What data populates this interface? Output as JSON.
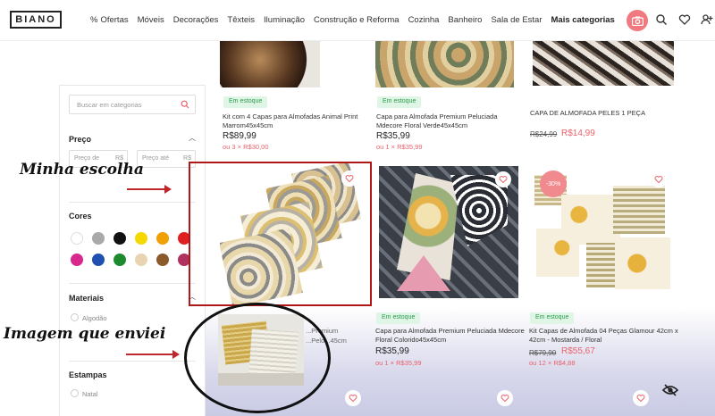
{
  "header": {
    "logo": "BIANO",
    "nav": [
      "Ofertas",
      "Móveis",
      "Decorações",
      "Têxteis",
      "Iluminação",
      "Construção e Reforma",
      "Cozinha",
      "Banheiro",
      "Sala de Estar",
      "Mais categorias"
    ],
    "ofertas_prefix": "%"
  },
  "sidebar": {
    "search_placeholder": "Buscar em categorias",
    "price_title": "Preço",
    "price_from": "Preço de",
    "price_to": "Preço até",
    "currency": "R$",
    "colors_title": "Cores",
    "colors": [
      "#ffffff",
      "#a9a9a9",
      "#111111",
      "#f5d800",
      "#f0a000",
      "#e02020",
      "#d8288e",
      "#1f4fb0",
      "#1e8a2e",
      "#e8d4b0",
      "#8a5a2b",
      "#b03060"
    ],
    "materials_title": "Materiais",
    "materials": [
      "Algodão"
    ],
    "prints_title": "Estampas",
    "prints": [
      "Natal"
    ]
  },
  "products": {
    "row1": [
      {
        "badge": "Em estoque",
        "name": "Kit com 4 Capas para Almofadas Animal Print Marrom45x45cm",
        "price": "R$89,99",
        "installments": "ou 3 × R$30,00"
      },
      {
        "badge": "Em estoque",
        "name": "Capa para Almofada Premium Peluciada Mdecore Floral Verde45x45cm",
        "price": "R$35,99",
        "installments": "ou 1 × R$35,99"
      },
      {
        "name": "CAPA DE ALMOFADA PELES 1 PEÇA",
        "old_price": "R$24,99",
        "price": "R$14,99"
      }
    ],
    "row2_discount": "-30%",
    "row3": [
      {
        "name_partial": "...Premium",
        "name_partial2": "...Pelo...45cm"
      },
      {
        "badge": "Em estoque",
        "name": "Capa para Almofada Premium Peluciada Mdecore Floral Colorido45x45cm",
        "price": "R$35,99",
        "installments": "ou 1 × R$35,99"
      },
      {
        "badge": "Em estoque",
        "name": "Kit Capas de Almofada 04 Peças Glamour 42cm x 42cm - Mostarda / Floral",
        "old_price": "R$79,90",
        "price": "R$55,67",
        "installments": "ou 12 × R$4,88"
      }
    ]
  },
  "annotations": {
    "choice": "Minha escolha",
    "sent": "Imagem que enviei"
  }
}
